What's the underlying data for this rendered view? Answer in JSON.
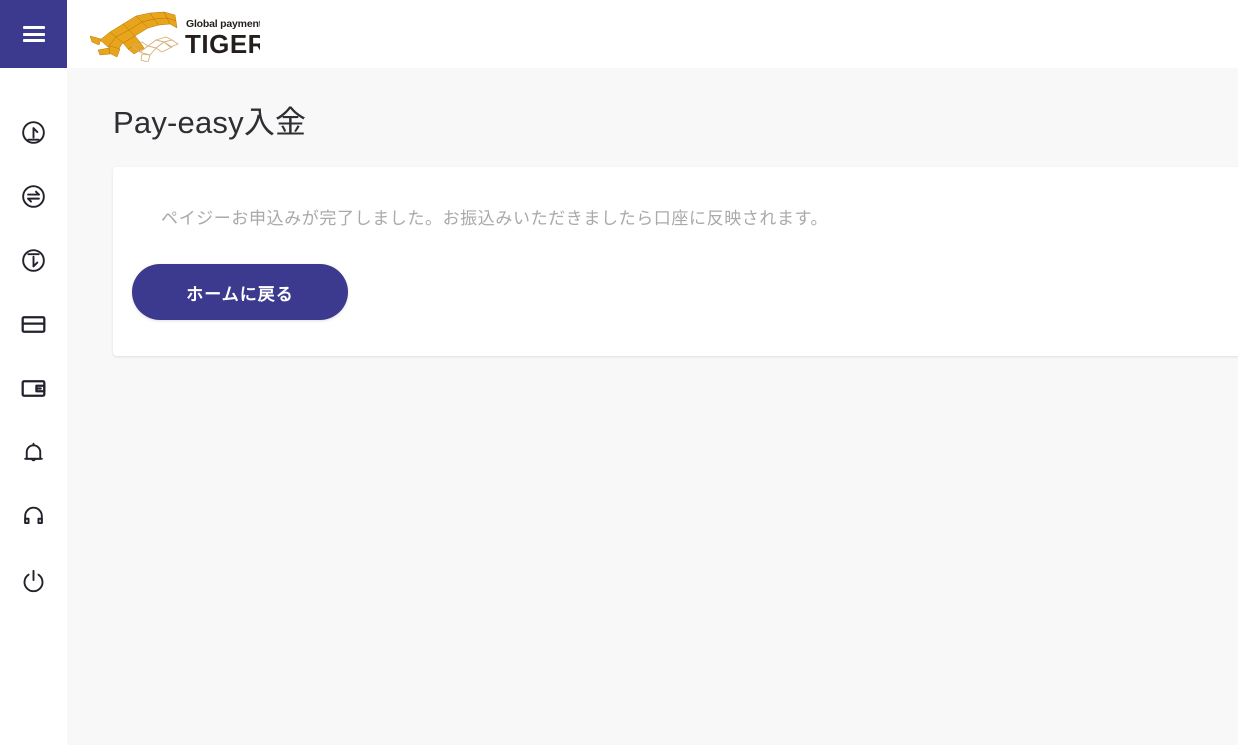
{
  "brand": {
    "name": "TIGER PAY",
    "tagline": "Global payment solution",
    "logo_icon": "tiger-logo",
    "accent_color": "#3b3a8f",
    "logo_gold": "#e8a51c"
  },
  "header": {
    "menu_button_icon": "hamburger-menu-icon"
  },
  "sidebar": {
    "items": [
      {
        "icon": "deposit-circle-arrow-up-icon",
        "label": "入金"
      },
      {
        "icon": "exchange-circle-arrows-icon",
        "label": "両替"
      },
      {
        "icon": "withdraw-circle-arrow-down-icon",
        "label": "出金"
      },
      {
        "icon": "credit-card-icon",
        "label": "カード"
      },
      {
        "icon": "wallet-icon",
        "label": "ウォレット"
      },
      {
        "icon": "bell-icon",
        "label": "お知らせ"
      },
      {
        "icon": "headset-icon",
        "label": "サポート"
      },
      {
        "icon": "power-icon",
        "label": "ログアウト"
      }
    ]
  },
  "main": {
    "page_title": "Pay-easy入金",
    "card": {
      "message": "ペイジーお申込みが完了しました。お振込みいただきましたら口座に反映されます。",
      "home_button_label": "ホームに戻る"
    }
  }
}
